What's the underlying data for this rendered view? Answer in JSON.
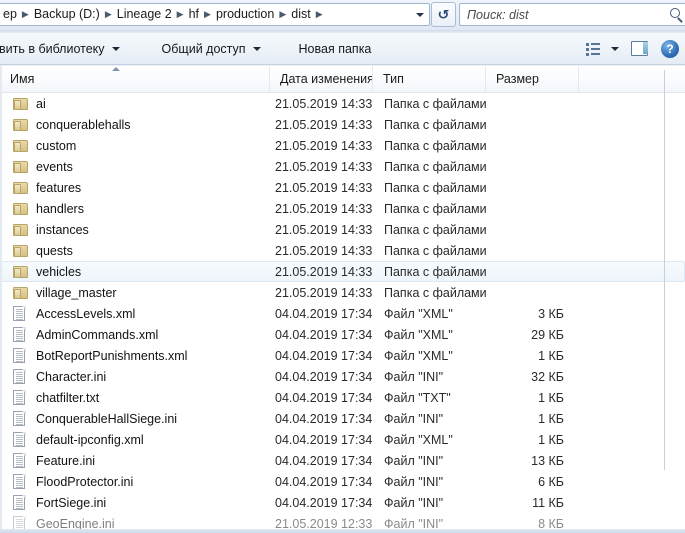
{
  "address_bar": {
    "crumbs": [
      "ep",
      "Backup (D:)",
      "Lineage 2",
      "hf",
      "production",
      "dist"
    ],
    "separator": "▶",
    "dropdown_icon": "chevron-down-icon",
    "refresh_icon": "↺",
    "refresh_glyph": "↺"
  },
  "search": {
    "placeholder": "Поиск: dist",
    "value": "",
    "icon": "search-icon"
  },
  "toolbar": {
    "items": [
      {
        "label": "вить в библиотеку",
        "has_caret": true
      },
      {
        "label": "Общий доступ",
        "has_caret": true
      },
      {
        "label": "Новая папка",
        "has_caret": false
      }
    ],
    "view_mode_icon": "view-options-icon",
    "view_mode_caret": "chevron-down-icon",
    "preview_pane_icon": "preview-pane-icon",
    "help_icon_label": "?"
  },
  "list": {
    "columns": [
      {
        "key": "name",
        "label": "Имя",
        "sorted": "asc"
      },
      {
        "key": "date",
        "label": "Дата изменения",
        "sorted": ""
      },
      {
        "key": "type",
        "label": "Тип",
        "sorted": ""
      },
      {
        "key": "size",
        "label": "Размер",
        "sorted": ""
      }
    ],
    "rows": [
      {
        "name": "ai",
        "date": "21.05.2019 14:33",
        "type": "Папка с файлами",
        "size": "",
        "icon": "folder-icon",
        "selected": false
      },
      {
        "name": "conquerablehalls",
        "date": "21.05.2019 14:33",
        "type": "Папка с файлами",
        "size": "",
        "icon": "folder-icon",
        "selected": false
      },
      {
        "name": "custom",
        "date": "21.05.2019 14:33",
        "type": "Папка с файлами",
        "size": "",
        "icon": "folder-icon",
        "selected": false
      },
      {
        "name": "events",
        "date": "21.05.2019 14:33",
        "type": "Папка с файлами",
        "size": "",
        "icon": "folder-icon",
        "selected": false
      },
      {
        "name": "features",
        "date": "21.05.2019 14:33",
        "type": "Папка с файлами",
        "size": "",
        "icon": "folder-icon",
        "selected": false
      },
      {
        "name": "handlers",
        "date": "21.05.2019 14:33",
        "type": "Папка с файлами",
        "size": "",
        "icon": "folder-icon",
        "selected": false
      },
      {
        "name": "instances",
        "date": "21.05.2019 14:33",
        "type": "Папка с файлами",
        "size": "",
        "icon": "folder-icon",
        "selected": false
      },
      {
        "name": "quests",
        "date": "21.05.2019 14:33",
        "type": "Папка с файлами",
        "size": "",
        "icon": "folder-icon",
        "selected": false
      },
      {
        "name": "vehicles",
        "date": "21.05.2019 14:33",
        "type": "Папка с файлами",
        "size": "",
        "icon": "folder-icon",
        "selected": true
      },
      {
        "name": "village_master",
        "date": "21.05.2019 14:33",
        "type": "Папка с файлами",
        "size": "",
        "icon": "folder-icon",
        "selected": false
      },
      {
        "name": "AccessLevels.xml",
        "date": "04.04.2019 17:34",
        "type": "Файл \"XML\"",
        "size": "3 КБ",
        "icon": "file-icon",
        "selected": false
      },
      {
        "name": "AdminCommands.xml",
        "date": "04.04.2019 17:34",
        "type": "Файл \"XML\"",
        "size": "29 КБ",
        "icon": "file-icon",
        "selected": false
      },
      {
        "name": "BotReportPunishments.xml",
        "date": "04.04.2019 17:34",
        "type": "Файл \"XML\"",
        "size": "1 КБ",
        "icon": "file-icon",
        "selected": false
      },
      {
        "name": "Character.ini",
        "date": "04.04.2019 17:34",
        "type": "Файл \"INI\"",
        "size": "32 КБ",
        "icon": "file-icon",
        "selected": false
      },
      {
        "name": "chatfilter.txt",
        "date": "04.04.2019 17:34",
        "type": "Файл \"TXT\"",
        "size": "1 КБ",
        "icon": "file-icon",
        "selected": false
      },
      {
        "name": "ConquerableHallSiege.ini",
        "date": "04.04.2019 17:34",
        "type": "Файл \"INI\"",
        "size": "1 КБ",
        "icon": "file-icon",
        "selected": false
      },
      {
        "name": "default-ipconfig.xml",
        "date": "04.04.2019 17:34",
        "type": "Файл \"XML\"",
        "size": "1 КБ",
        "icon": "file-icon",
        "selected": false
      },
      {
        "name": "Feature.ini",
        "date": "04.04.2019 17:34",
        "type": "Файл \"INI\"",
        "size": "13 КБ",
        "icon": "file-icon",
        "selected": false
      },
      {
        "name": "FloodProtector.ini",
        "date": "04.04.2019 17:34",
        "type": "Файл \"INI\"",
        "size": "6 КБ",
        "icon": "file-icon",
        "selected": false
      },
      {
        "name": "FortSiege.ini",
        "date": "04.04.2019 17:34",
        "type": "Файл \"INI\"",
        "size": "11 КБ",
        "icon": "file-icon",
        "selected": false
      },
      {
        "name": "GeoEngine.ini",
        "date": "21.05.2019 12:33",
        "type": "Файл \"INI\"",
        "size": "8 КБ",
        "icon": "file-icon",
        "selected": false,
        "partial": true
      }
    ]
  }
}
